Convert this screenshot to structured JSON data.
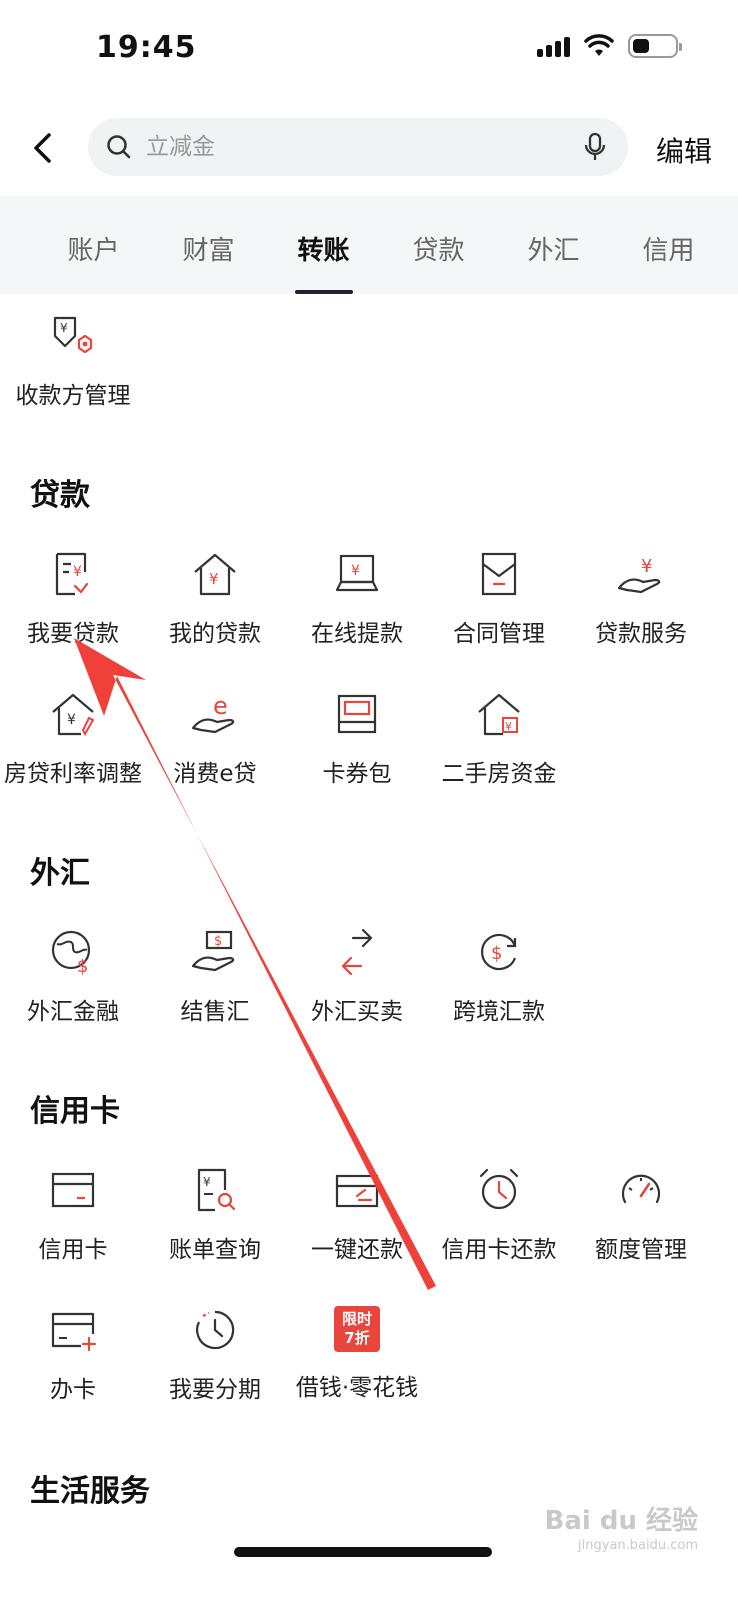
{
  "status_bar": {
    "time": "19:45"
  },
  "nav": {
    "search_placeholder": "立减金",
    "edit_label": "编辑"
  },
  "tabs": [
    {
      "label": "账户"
    },
    {
      "label": "财富"
    },
    {
      "label": "转账",
      "active": true
    },
    {
      "label": "贷款"
    },
    {
      "label": "外汇"
    },
    {
      "label": "信用"
    }
  ],
  "transfer": {
    "items": [
      {
        "label": "收款方管理",
        "icon": "payee-manage-icon"
      }
    ]
  },
  "loans": {
    "title": "贷款",
    "items": [
      {
        "label": "我要贷款",
        "icon": "loan-apply-icon"
      },
      {
        "label": "我的贷款",
        "icon": "my-loan-icon"
      },
      {
        "label": "在线提款",
        "icon": "online-withdraw-icon"
      },
      {
        "label": "合同管理",
        "icon": "contract-icon"
      },
      {
        "label": "贷款服务",
        "icon": "loan-service-icon"
      },
      {
        "label": "房贷利率调整",
        "icon": "mortgage-rate-icon"
      },
      {
        "label": "消费e贷",
        "icon": "consumer-loan-icon"
      },
      {
        "label": "卡券包",
        "icon": "coupon-wallet-icon"
      },
      {
        "label": "二手房资金",
        "icon": "second-hand-house-icon"
      }
    ]
  },
  "forex": {
    "title": "外汇",
    "items": [
      {
        "label": "外汇金融",
        "icon": "forex-finance-icon"
      },
      {
        "label": "结售汇",
        "icon": "exchange-settle-icon"
      },
      {
        "label": "外汇买卖",
        "icon": "forex-trade-icon"
      },
      {
        "label": "跨境汇款",
        "icon": "cross-border-icon"
      }
    ]
  },
  "credit": {
    "title": "信用卡",
    "items": [
      {
        "label": "信用卡",
        "icon": "credit-card-icon"
      },
      {
        "label": "账单查询",
        "icon": "bill-query-icon"
      },
      {
        "label": "一键还款",
        "icon": "one-click-repay-icon"
      },
      {
        "label": "信用卡还款",
        "icon": "card-repay-clock-icon"
      },
      {
        "label": "额度管理",
        "icon": "limit-gauge-icon"
      },
      {
        "label": "办卡",
        "icon": "apply-card-icon"
      },
      {
        "label": "我要分期",
        "icon": "installment-clock-icon"
      },
      {
        "label": "借钱·零花钱",
        "icon": "promo-badge",
        "badge": "限时\n7折"
      }
    ]
  },
  "life": {
    "title": "生活服务"
  },
  "watermark": {
    "text": "Bai du 经验",
    "sub": "jingyan.baidu.com"
  },
  "colors": {
    "accent": "#e8453c",
    "text": "#222222",
    "tab_bg": "#f5f6f8",
    "arrow": "#f0403a"
  }
}
